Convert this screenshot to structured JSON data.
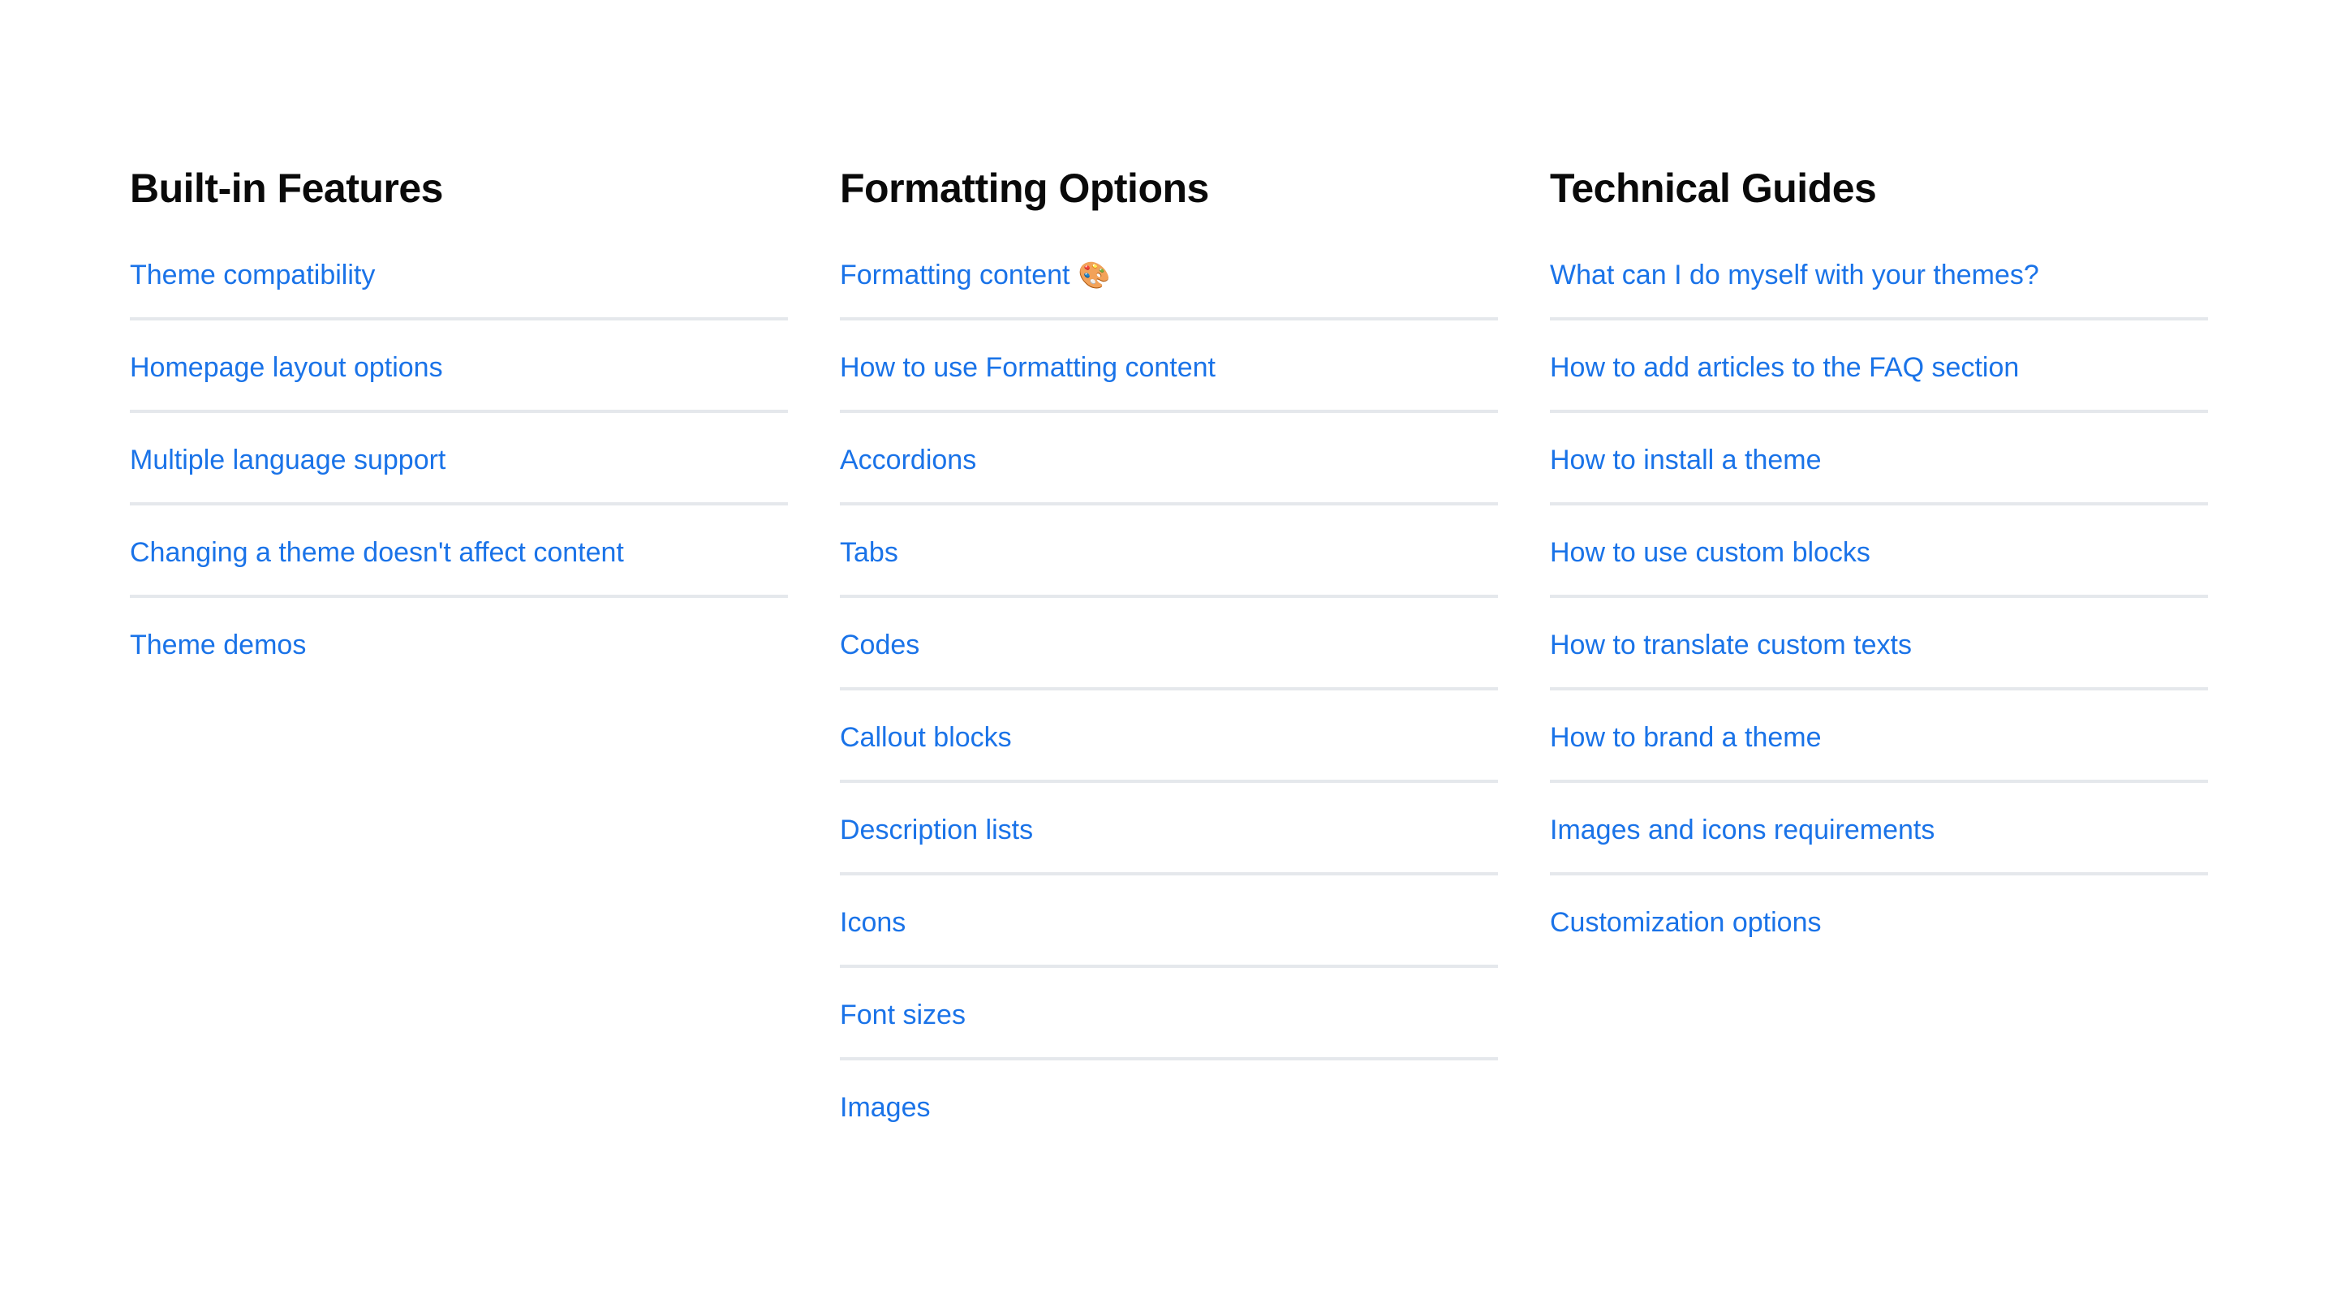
{
  "colors": {
    "link": "#1a73e8",
    "heading": "#0a0a0a",
    "divider": "#e5e8ec",
    "background": "#ffffff"
  },
  "columns": [
    {
      "title": "Built-in Features",
      "items": [
        {
          "label": "Theme compatibility",
          "emoji": ""
        },
        {
          "label": "Homepage layout options",
          "emoji": ""
        },
        {
          "label": "Multiple language support",
          "emoji": ""
        },
        {
          "label": "Changing a theme doesn't affect content",
          "emoji": ""
        },
        {
          "label": "Theme demos",
          "emoji": ""
        }
      ]
    },
    {
      "title": "Formatting Options",
      "items": [
        {
          "label": "Formatting content",
          "emoji": "🎨",
          "emoji_name": "artist-palette-icon"
        },
        {
          "label": "How to use Formatting content",
          "emoji": ""
        },
        {
          "label": "Accordions",
          "emoji": ""
        },
        {
          "label": "Tabs",
          "emoji": ""
        },
        {
          "label": "Codes",
          "emoji": ""
        },
        {
          "label": "Callout blocks",
          "emoji": ""
        },
        {
          "label": "Description lists",
          "emoji": ""
        },
        {
          "label": "Icons",
          "emoji": ""
        },
        {
          "label": "Font sizes",
          "emoji": ""
        },
        {
          "label": "Images",
          "emoji": ""
        }
      ]
    },
    {
      "title": "Technical Guides",
      "items": [
        {
          "label": "What can I do myself with your themes?",
          "emoji": ""
        },
        {
          "label": "How to add articles to the FAQ section",
          "emoji": ""
        },
        {
          "label": "How to install a theme",
          "emoji": ""
        },
        {
          "label": "How to use custom blocks",
          "emoji": ""
        },
        {
          "label": "How to translate custom texts",
          "emoji": ""
        },
        {
          "label": "How to brand a theme",
          "emoji": ""
        },
        {
          "label": "Images and icons requirements",
          "emoji": ""
        },
        {
          "label": "Customization options",
          "emoji": ""
        }
      ]
    }
  ]
}
